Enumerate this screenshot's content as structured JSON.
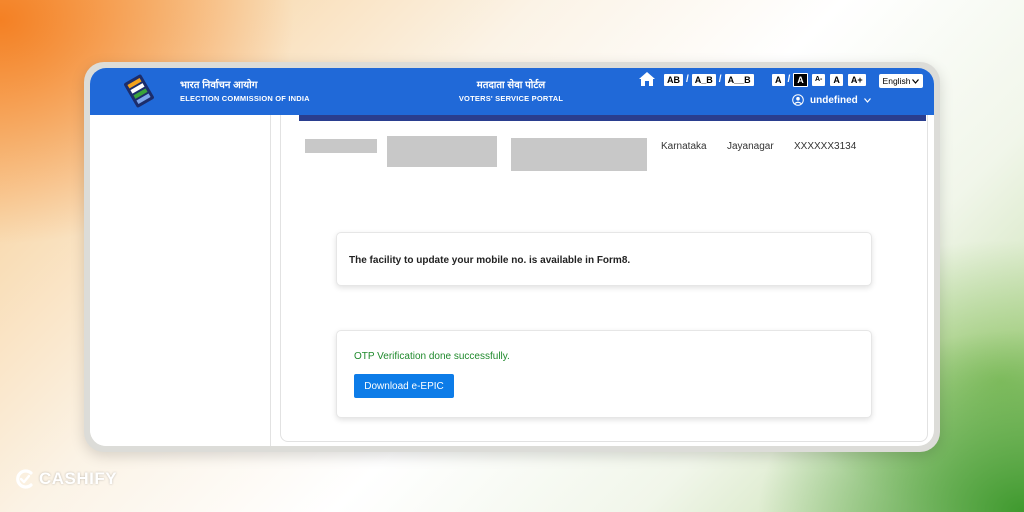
{
  "header": {
    "org_hindi": "भारत निर्वाचन आयोग",
    "org_english": "ELECTION COMMISSION OF INDIA",
    "portal_hindi": "मतदाता सेवा पोर्टल",
    "portal_english": "VOTERS' SERVICE PORTAL",
    "accessibility": {
      "b1": "AB",
      "b2": "A_B",
      "b3": "A__B",
      "b4": "A",
      "b5": "A",
      "b6": "A-",
      "b7": "A",
      "b8": "A+",
      "sep": "/"
    },
    "language": "English",
    "username": "undefined"
  },
  "details": {
    "state": "Karnataka",
    "constituency": "Jayanagar",
    "epic_number": "XXXXXX3134"
  },
  "mobile_notice": "The facility to update your mobile no. is available in Form8.",
  "otp": {
    "message": "OTP Verification done successfully.",
    "download_label": "Download e-EPIC"
  },
  "watermark": "CASHIFY",
  "colors": {
    "header_bg": "#2069d8",
    "button_bg": "#0d7ce8",
    "success_text": "#1f8a2c",
    "strip": "#2a3e8f"
  },
  "icons": [
    "ballot-logo-icon",
    "home-icon",
    "chevron-down-icon",
    "user-icon"
  ]
}
